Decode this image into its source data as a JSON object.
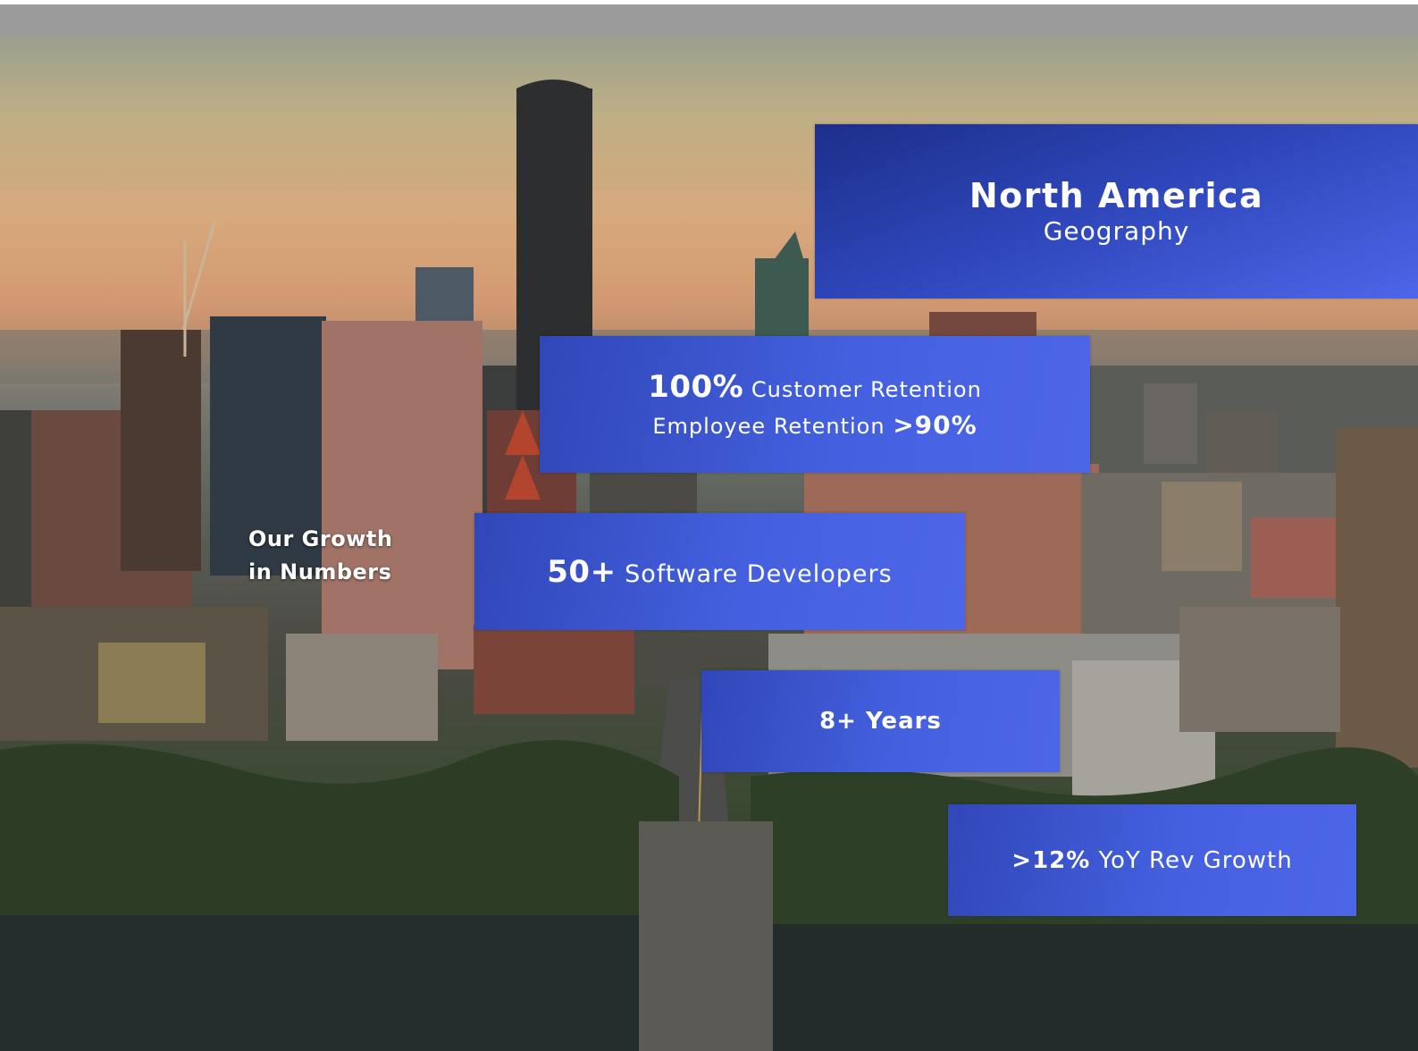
{
  "slide": {
    "heading_line1": "Our Growth",
    "heading_line2": "in Numbers",
    "geography": {
      "region": "North America",
      "label": "Geography"
    },
    "retention": {
      "customer_value": "100%",
      "customer_label": "Customer Retention",
      "employee_label": "Employee Retention",
      "employee_value": ">90%"
    },
    "developers": {
      "value": "50+",
      "label": "Software Developers"
    },
    "years": {
      "value": "8+ Years"
    },
    "growth": {
      "value": ">12%",
      "label": "YoY Rev Growth"
    }
  },
  "colors": {
    "card_blue": "#4460df",
    "card_dark_blue": "#1d2f8a",
    "topbar_gray": "#9b9b9b",
    "text_white": "#ffffff"
  }
}
